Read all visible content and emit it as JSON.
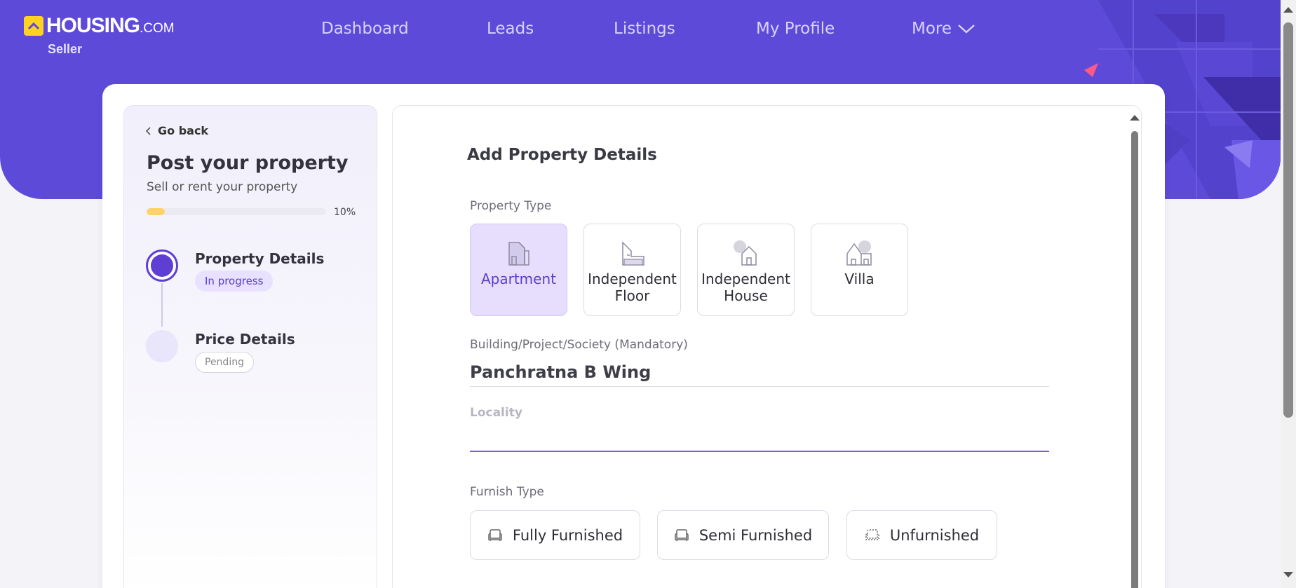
{
  "brand": {
    "name": "HOUSING",
    "suffix": ".COM",
    "subtitle": "Seller",
    "accent": "#5e4ad9",
    "logo_color": "#ffd21f"
  },
  "nav": {
    "items": [
      {
        "label": "Dashboard"
      },
      {
        "label": "Leads"
      },
      {
        "label": "Listings"
      },
      {
        "label": "My Profile"
      }
    ],
    "more_label": "More",
    "more_icon": "chevron-down-icon"
  },
  "sidebar": {
    "go_back": "Go back",
    "title": "Post your property",
    "subtitle": "Sell or rent your property",
    "progress_percent": 10,
    "progress_label": "10%",
    "steps": [
      {
        "title": "Property Details",
        "status": "In progress"
      },
      {
        "title": "Price Details",
        "status": "Pending"
      }
    ]
  },
  "form": {
    "title": "Add Property Details",
    "property_type_label": "Property Type",
    "property_types": [
      {
        "label": "Apartment",
        "icon": "apartment-icon",
        "selected": true
      },
      {
        "label": "Independent Floor",
        "icon": "independent-floor-icon",
        "selected": false
      },
      {
        "label": "Independent House",
        "icon": "independent-house-icon",
        "selected": false
      },
      {
        "label": "Villa",
        "icon": "villa-icon",
        "selected": false
      }
    ],
    "building_label": "Building/Project/Society (Mandatory)",
    "building_value": "Panchratna B Wing",
    "locality_label": "Locality",
    "locality_value": "",
    "furnish_label": "Furnish Type",
    "furnish_types": [
      {
        "label": "Fully Furnished",
        "icon": "sofa-icon"
      },
      {
        "label": "Semi Furnished",
        "icon": "sofa-icon"
      },
      {
        "label": "Unfurnished",
        "icon": "empty-sofa-icon"
      }
    ]
  }
}
